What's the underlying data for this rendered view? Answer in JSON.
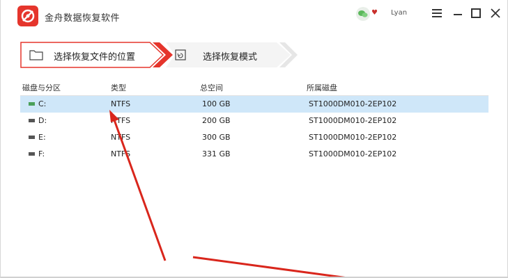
{
  "app": {
    "title": "金舟数据恢复软件",
    "username": "Lyan",
    "accent_color": "#e5352c"
  },
  "steps": [
    {
      "label": "选择恢复文件的位置",
      "active": true,
      "icon": "folder-icon"
    },
    {
      "label": "选择恢复模式",
      "active": false,
      "icon": "restore-icon"
    }
  ],
  "table": {
    "headers": [
      "磁盘与分区",
      "类型",
      "总空间",
      "所属磁盘"
    ],
    "rows": [
      {
        "drive": "C:",
        "type": "NTFS",
        "size": "100 GB",
        "disk": "ST1000DM010-2EP102",
        "selected": true
      },
      {
        "drive": "D:",
        "type": "NTFS",
        "size": "200 GB",
        "disk": "ST1000DM010-2EP102",
        "selected": false
      },
      {
        "drive": "E:",
        "type": "NTFS",
        "size": "300 GB",
        "disk": "ST1000DM010-2EP102",
        "selected": false
      },
      {
        "drive": "F:",
        "type": "NTFS",
        "size": "331 GB",
        "disk": "ST1000DM010-2EP102",
        "selected": false
      }
    ]
  },
  "annotation": {
    "arrow_color": "#d9261c"
  }
}
